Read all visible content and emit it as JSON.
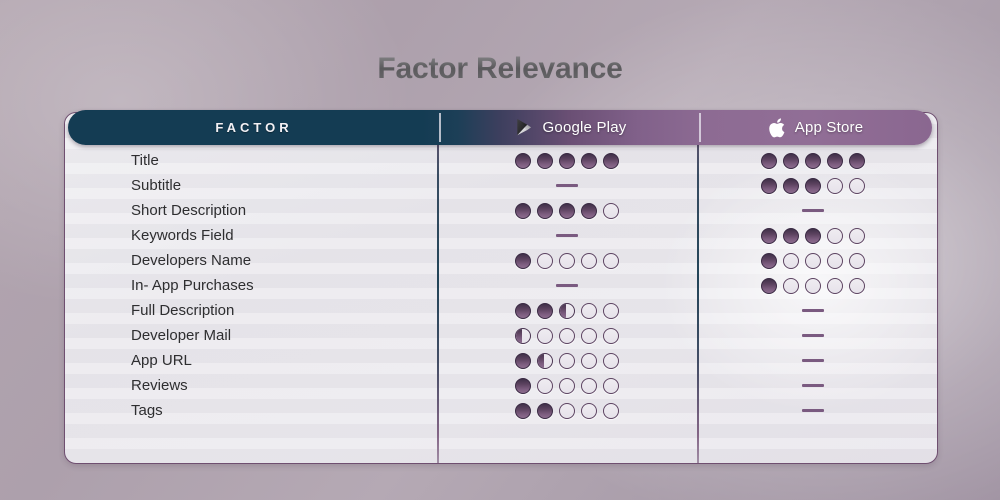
{
  "title": "Factor Relevance",
  "table": {
    "columns": [
      {
        "key": "factor",
        "label": "FACTOR",
        "icon": null
      },
      {
        "key": "google_play",
        "label": "Google Play",
        "icon": "google-play-icon"
      },
      {
        "key": "app_store",
        "label": "App Store",
        "icon": "apple-icon"
      }
    ],
    "rating_scale_max": 5,
    "rows": [
      {
        "factor": "Title",
        "google_play": {
          "type": "rating",
          "full": 5,
          "half": 0
        },
        "app_store": {
          "type": "rating",
          "full": 5,
          "half": 0
        }
      },
      {
        "factor": "Subtitle",
        "google_play": {
          "type": "dash"
        },
        "app_store": {
          "type": "rating",
          "full": 3,
          "half": 0
        }
      },
      {
        "factor": "Short Description",
        "google_play": {
          "type": "rating",
          "full": 4,
          "half": 0
        },
        "app_store": {
          "type": "dash"
        }
      },
      {
        "factor": "Keywords Field",
        "google_play": {
          "type": "dash"
        },
        "app_store": {
          "type": "rating",
          "full": 3,
          "half": 0
        }
      },
      {
        "factor": "Developers Name",
        "google_play": {
          "type": "rating",
          "full": 1,
          "half": 0
        },
        "app_store": {
          "type": "rating",
          "full": 1,
          "half": 0
        }
      },
      {
        "factor": "In- App Purchases",
        "google_play": {
          "type": "dash"
        },
        "app_store": {
          "type": "rating",
          "full": 1,
          "half": 0
        }
      },
      {
        "factor": "Full Description",
        "google_play": {
          "type": "rating",
          "full": 2,
          "half": 1
        },
        "app_store": {
          "type": "dash"
        }
      },
      {
        "factor": "Developer Mail",
        "google_play": {
          "type": "rating",
          "full": 0,
          "half": 1
        },
        "app_store": {
          "type": "dash"
        }
      },
      {
        "factor": "App URL",
        "google_play": {
          "type": "rating",
          "full": 1,
          "half": 1
        },
        "app_store": {
          "type": "dash"
        }
      },
      {
        "factor": "Reviews",
        "google_play": {
          "type": "rating",
          "full": 1,
          "half": 0
        },
        "app_store": {
          "type": "dash"
        }
      },
      {
        "factor": "Tags",
        "google_play": {
          "type": "rating",
          "full": 2,
          "half": 0
        },
        "app_store": {
          "type": "dash"
        }
      }
    ]
  },
  "colors": {
    "header_dark": "#143c53",
    "header_purple": "#8d6b93",
    "card_border": "#6f4f70",
    "dot_fill": "#5d4360",
    "dot_empty_border": "#5d4462",
    "dash": "#7a5a80",
    "background": "#ada0ac",
    "title_text": "#5a595c",
    "row_label_text": "#2e2e30"
  }
}
